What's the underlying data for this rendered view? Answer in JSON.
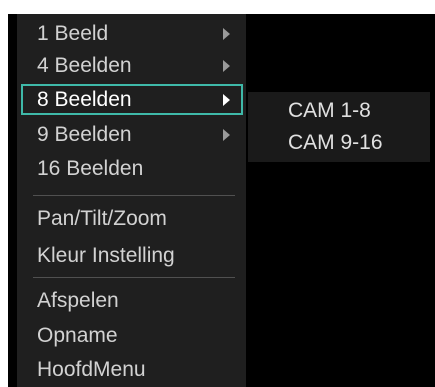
{
  "menu": {
    "items": [
      {
        "label": "1 Beeld",
        "has_submenu": true
      },
      {
        "label": "4 Beelden",
        "has_submenu": true
      },
      {
        "label": "8 Beelden",
        "has_submenu": true,
        "selected": true
      },
      {
        "label": "9 Beelden",
        "has_submenu": true
      },
      {
        "label": "16 Beelden",
        "has_submenu": false
      },
      {
        "label": "Pan/Tilt/Zoom",
        "has_submenu": false
      },
      {
        "label": "Kleur Instelling",
        "has_submenu": false
      },
      {
        "label": "Afspelen",
        "has_submenu": false
      },
      {
        "label": "Opname",
        "has_submenu": false
      },
      {
        "label": "HoofdMenu",
        "has_submenu": false
      }
    ]
  },
  "submenu": {
    "items": [
      {
        "label": "CAM 1-8"
      },
      {
        "label": "CAM 9-16"
      }
    ]
  },
  "colors": {
    "menu_background": "#1f1f1f",
    "selection_border": "#3fb9a9",
    "text": "#d2d2d2",
    "submenu_background": "#1a1a1a"
  }
}
